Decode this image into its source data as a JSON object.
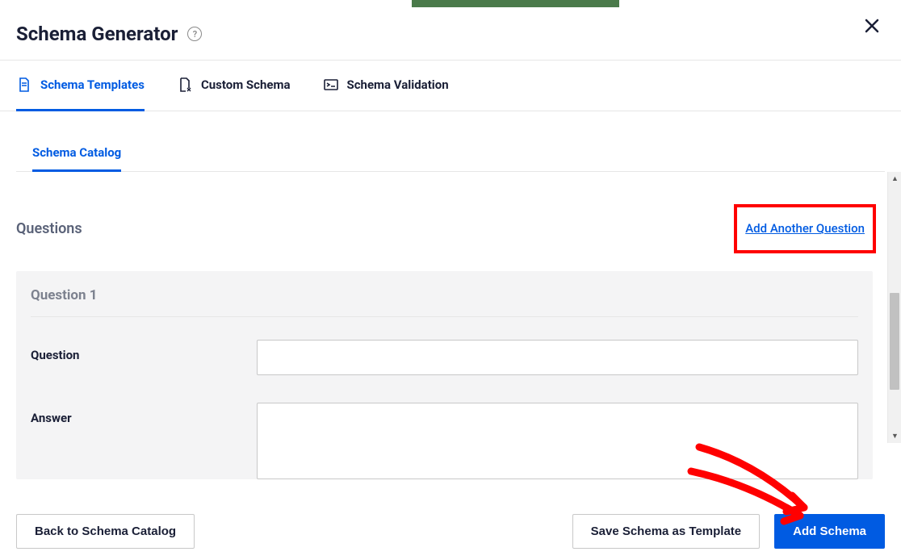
{
  "header": {
    "title": "Schema Generator"
  },
  "tabs": [
    {
      "label": "Schema Templates",
      "active": true
    },
    {
      "label": "Custom Schema",
      "active": false
    },
    {
      "label": "Schema Validation",
      "active": false
    }
  ],
  "subtabs": [
    {
      "label": "Schema Catalog",
      "active": true
    }
  ],
  "questions": {
    "section_label": "Questions",
    "add_label": "Add Another Question",
    "items": [
      {
        "title": "Question 1",
        "question_label": "Question",
        "question_value": "",
        "answer_label": "Answer",
        "answer_value": ""
      }
    ]
  },
  "footer": {
    "back_label": "Back to Schema Catalog",
    "save_label": "Save Schema as Template",
    "add_label": "Add Schema"
  }
}
